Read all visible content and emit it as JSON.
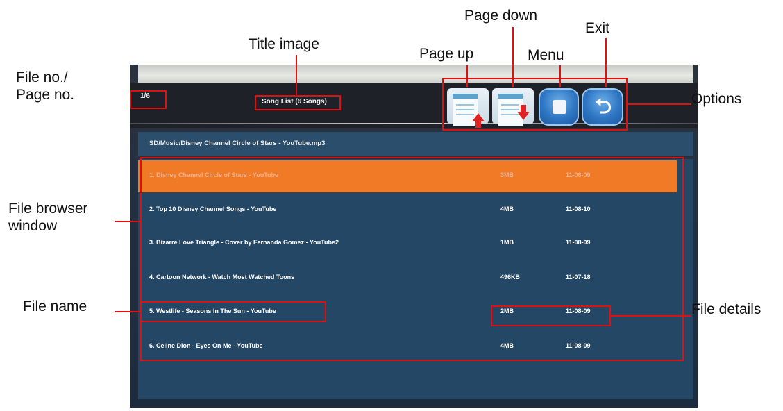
{
  "callouts": {
    "file_page_no_line1": "File no./",
    "file_page_no_line2": "Page no.",
    "title_image": "Title image",
    "page_up": "Page up",
    "page_down": "Page down",
    "menu": "Menu",
    "exit": "Exit",
    "options": "Options",
    "file_browser_line1": "File browser",
    "file_browser_line2": "window",
    "file_name": "File name",
    "file_details": "File details"
  },
  "screen": {
    "counter": "1/6",
    "title": "Song List (6 Songs)",
    "path": "SD/Music/Disney Channel Circle of Stars - YouTube.mp3",
    "options": [
      {
        "name": "page-up",
        "icon": "page-up-icon"
      },
      {
        "name": "page-down",
        "icon": "page-down-icon"
      },
      {
        "name": "menu",
        "icon": "menu-icon"
      },
      {
        "name": "exit",
        "icon": "return-arrow-icon",
        "glyph": "⮌"
      }
    ],
    "files": [
      {
        "name": "1. Disney Channel Circle of Stars - YouTube",
        "size": "3MB",
        "date": "11-08-09",
        "selected": true
      },
      {
        "name": "2. Top 10 Disney Channel Songs  - YouTube",
        "size": "4MB",
        "date": "11-08-10"
      },
      {
        "name": "3. Bizarre Love Triangle - Cover by Fernanda Gomez  - YouTube2",
        "size": "1MB",
        "date": "11-08-09"
      },
      {
        "name": "4. Cartoon Network - Watch Most Watched Toons",
        "size": "496KB",
        "date": "11-07-18"
      },
      {
        "name": "5. Westlife - Seasons In The Sun  - YouTube",
        "size": "2MB",
        "date": "11-08-09"
      },
      {
        "name": "6. Celine Dion - Eyes On Me  - YouTube",
        "size": "4MB",
        "date": "11-08-09"
      }
    ]
  },
  "colors": {
    "annotation": "#e01010",
    "selected_row": "#f07a26",
    "list_background": "#244766",
    "button_blue": "#2f77c4",
    "arrow_red": "#e02424"
  }
}
